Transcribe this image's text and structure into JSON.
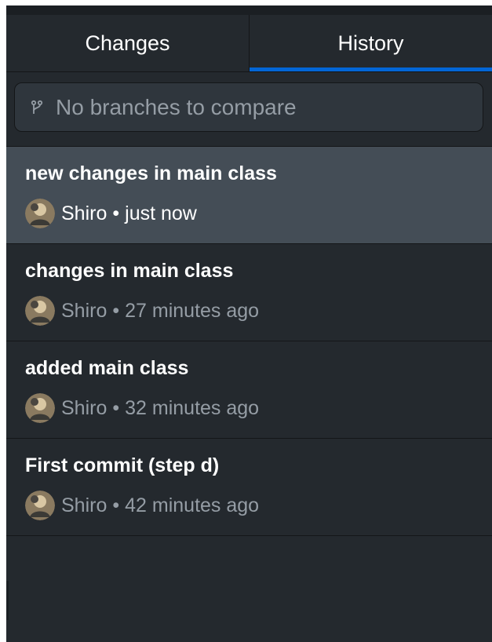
{
  "tabs": [
    {
      "label": "Changes",
      "selected": false
    },
    {
      "label": "History",
      "selected": true
    }
  ],
  "branch_select": {
    "icon": "git-branch-icon",
    "text": "No branches to compare"
  },
  "commits": [
    {
      "title": "new changes in main class",
      "author": "Shiro",
      "separator": "•",
      "time": "just now",
      "selected": true
    },
    {
      "title": "changes in main class",
      "author": "Shiro",
      "separator": "•",
      "time": "27 minutes ago",
      "selected": false
    },
    {
      "title": "added main class",
      "author": "Shiro",
      "separator": "•",
      "time": "32 minutes ago",
      "selected": false
    },
    {
      "title": "First commit (step d)",
      "author": "Shiro",
      "separator": "•",
      "time": "42 minutes ago",
      "selected": false
    }
  ],
  "colors": {
    "background": "#24292e",
    "selected_row": "#444d56",
    "accent": "#0366d6",
    "muted_text": "#959da5"
  }
}
